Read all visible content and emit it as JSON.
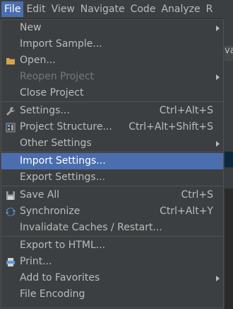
{
  "menubar": {
    "items": [
      {
        "label": "File",
        "mnemonic": "F",
        "active": true
      },
      {
        "label": "Edit",
        "mnemonic": "E"
      },
      {
        "label": "View",
        "mnemonic": "V"
      },
      {
        "label": "Navigate",
        "mnemonic": "N"
      },
      {
        "label": "Code",
        "mnemonic": "C"
      },
      {
        "label": "Analyze",
        "mnemonic": "z"
      },
      {
        "label": "R",
        "mnemonic": "R"
      }
    ],
    "background_fragment": "va"
  },
  "file_menu": {
    "items": [
      {
        "label": "New",
        "submenu": true
      },
      {
        "label": "Import Sample..."
      },
      {
        "label": "Open...",
        "icon": "folder-icon"
      },
      {
        "label": "Reopen Project",
        "submenu": true,
        "disabled": true
      },
      {
        "label": "Close Project"
      },
      {
        "separator": true
      },
      {
        "label": "Settings...",
        "icon": "wrench-icon",
        "shortcut": "Ctrl+Alt+S"
      },
      {
        "label": "Project Structure...",
        "icon": "project-structure-icon",
        "shortcut": "Ctrl+Alt+Shift+S"
      },
      {
        "label": "Other Settings",
        "submenu": true
      },
      {
        "separator": true
      },
      {
        "label": "Import Settings...",
        "selected": true
      },
      {
        "label": "Export Settings..."
      },
      {
        "separator": true
      },
      {
        "label": "Save All",
        "icon": "save-icon",
        "shortcut": "Ctrl+S"
      },
      {
        "label": "Synchronize",
        "icon": "sync-icon",
        "shortcut": "Ctrl+Alt+Y"
      },
      {
        "label": "Invalidate Caches / Restart..."
      },
      {
        "separator": true
      },
      {
        "label": "Export to HTML..."
      },
      {
        "label": "Print...",
        "icon": "print-icon"
      },
      {
        "label": "Add to Favorites",
        "submenu": true
      },
      {
        "label": "File Encoding"
      }
    ]
  },
  "colors": {
    "background": "#3c3f41",
    "selection": "#4b6eaf",
    "text": "#bbbbbb",
    "disabled_text": "#777777",
    "separator": "#515151"
  }
}
